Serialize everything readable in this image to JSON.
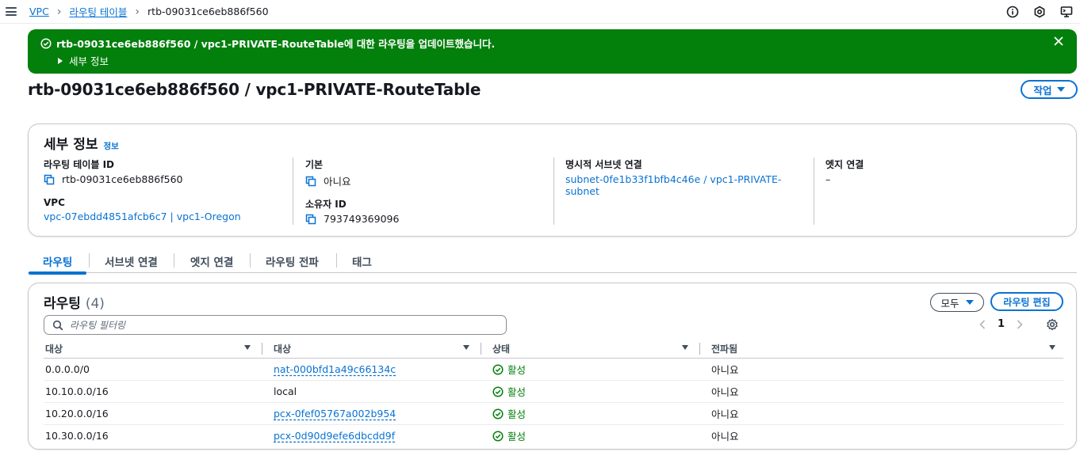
{
  "breadcrumb": {
    "items": [
      "VPC",
      "라우팅 테이블"
    ],
    "current": "rtb-09031ce6eb886f560"
  },
  "flash": {
    "message": "rtb-09031ce6eb886f560 / vpc1-PRIVATE-RouteTable에 대한 라우팅을 업데이트했습니다.",
    "details": "세부 정보"
  },
  "page": {
    "title": "rtb-09031ce6eb886f560 / vpc1-PRIVATE-RouteTable",
    "action_label": "작업"
  },
  "details": {
    "title": "세부 정보",
    "info": "정보",
    "route_table_id_label": "라우팅 테이블 ID",
    "route_table_id": "rtb-09031ce6eb886f560",
    "vpc_label": "VPC",
    "vpc": "vpc-07ebdd4851afcb6c7 | vpc1-Oregon",
    "main_label": "기본",
    "main": "아니요",
    "owner_label": "소유자 ID",
    "owner": "793749369096",
    "subnet_assoc_label": "명시적 서브넷 연결",
    "subnet_assoc": "subnet-0fe1b33f1bfb4c46e / vpc1-PRIVATE-subnet",
    "edge_assoc_label": "엣지 연결",
    "edge_assoc": "–"
  },
  "tabs": [
    "라우팅",
    "서브넷 연결",
    "엣지 연결",
    "라우팅 전파",
    "태그"
  ],
  "routes": {
    "title": "라우팅",
    "count": "(4)",
    "all_label": "모두",
    "edit_label": "라우팅 편집",
    "filter_placeholder": "라우팅 필터링",
    "page": "1",
    "columns": [
      "대상",
      "대상",
      "상태",
      "전파됨"
    ],
    "rows": [
      {
        "destination": "0.0.0.0/0",
        "target": "nat-000bfd1a49c66134c",
        "target_link": true,
        "status": "활성",
        "propagated": "아니요"
      },
      {
        "destination": "10.10.0.0/16",
        "target": "local",
        "target_link": false,
        "status": "활성",
        "propagated": "아니요"
      },
      {
        "destination": "10.20.0.0/16",
        "target": "pcx-0fef05767a002b954",
        "target_link": true,
        "status": "활성",
        "propagated": "아니요"
      },
      {
        "destination": "10.30.0.0/16",
        "target": "pcx-0d90d9efe6dbcdd9f",
        "target_link": true,
        "status": "활성",
        "propagated": "아니요"
      }
    ]
  },
  "colors": {
    "success": "#037f0c",
    "link": "#0972d3"
  }
}
